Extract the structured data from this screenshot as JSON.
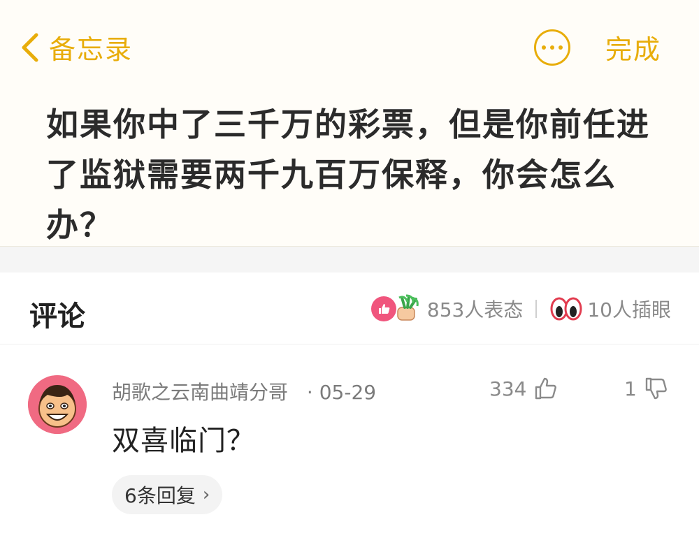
{
  "nav": {
    "back_label": "备忘录",
    "done_label": "完成",
    "accent_color": "#e8ad0a"
  },
  "note": {
    "text": "如果你中了三千万的彩票，但是你前任进了监狱需要两千九百万保释，你会怎么办？"
  },
  "comments": {
    "title": "评论",
    "reactions_count": "853人表态",
    "eyes_count": "10人插眼"
  },
  "comment": {
    "author": "胡歌之云南曲靖分哥",
    "date": "· 05-29",
    "likes": "334",
    "dislikes": "1",
    "text": "双喜临门？",
    "replies_label": "6条回复"
  },
  "icons": [
    "chevron-left-icon",
    "more-icon",
    "like-reaction-icon",
    "cheer-reaction-icon",
    "eyes-icon",
    "thumbs-up-icon",
    "thumbs-down-icon",
    "chevron-right-icon"
  ]
}
